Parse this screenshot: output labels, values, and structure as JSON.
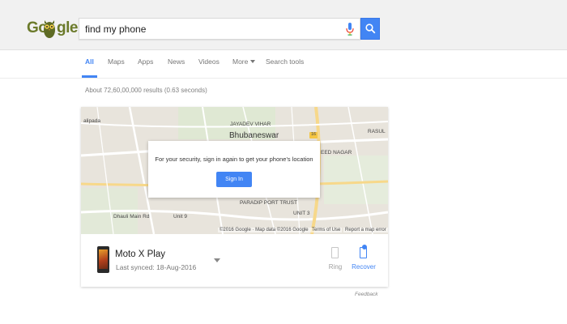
{
  "header": {
    "logo_text": "Google",
    "search_value": "find my phone"
  },
  "tabs": [
    {
      "label": "All",
      "active": true
    },
    {
      "label": "Maps"
    },
    {
      "label": "Apps"
    },
    {
      "label": "News"
    },
    {
      "label": "Videos"
    },
    {
      "label": "More"
    },
    {
      "label": "Search tools"
    }
  ],
  "result_stats": "About 72,60,00,000 results (0.63 seconds)",
  "map": {
    "labels": [
      "alipada",
      "JAYADEV VIHAR",
      "Bhubaneswar",
      "RASUL",
      "EED NAGAR",
      "PARADIP PORT TRUST",
      "UNIT 3",
      "Dhauli Main Rd",
      "Unit 9",
      "16"
    ],
    "footer_copyright": "©2016 Google · Map data ©2016 Google",
    "footer_terms": "Terms of Use",
    "footer_report": "Report a map error",
    "dialog_message": "For your security, sign in again to get your phone's location",
    "signin_label": "Sign In"
  },
  "device": {
    "name": "Moto X Play",
    "last_synced": "Last synced: 18-Aug-2016",
    "ring_label": "Ring",
    "recover_label": "Recover"
  },
  "feedback": "Feedback",
  "colors": {
    "accent": "#4285f4",
    "header_bg": "#f1f1f1",
    "map_bg": "#e8e4dc"
  }
}
